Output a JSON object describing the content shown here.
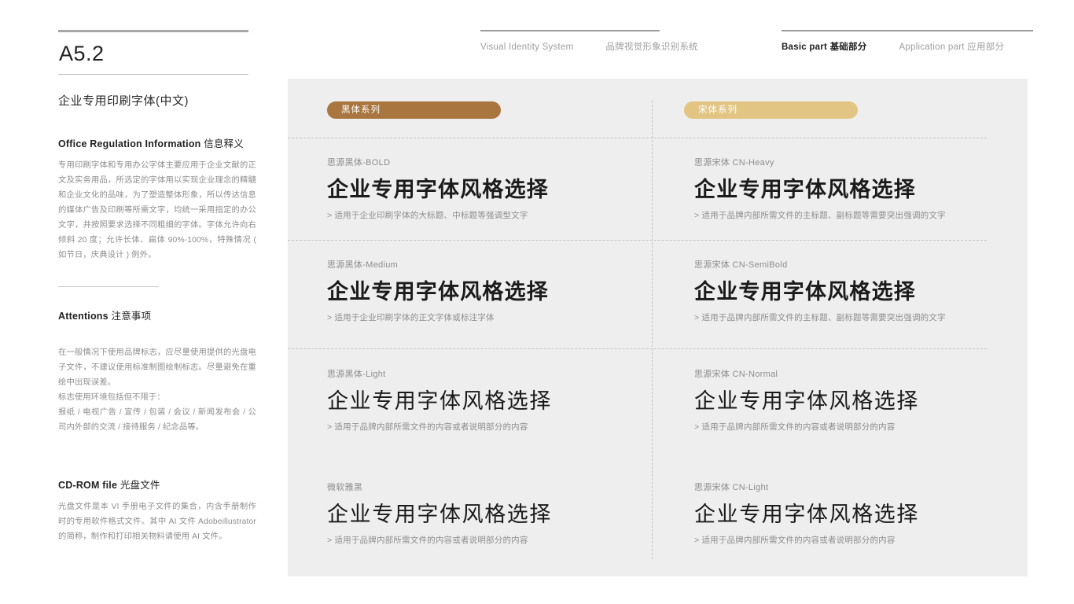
{
  "sidebar": {
    "code": "A5.2",
    "subject": "企业专用印刷字体(中文)",
    "sections": [
      {
        "heading_en": "Office Regulation Information",
        "heading_cn": "信息释义",
        "body": "专用印刷字体和专用办公字体主要应用于企业文献的正文及实务用品，所选定的字体用以实现企业理念的精髓和企业文化的品味，为了塑造整体形象，所以传达信息的媒体广告及印刷等所需文字，均统一采用指定的办公文字，并按照要求选择不同粗细的字体。字体允许向右倾斜 20 度；允许长体、扁体 90%-100%，特殊情况 ( 如节日，庆典设计 ) 例外。"
      },
      {
        "heading_en": "Attentions",
        "heading_cn": "注意事项",
        "body": "在一般情况下使用品牌标志，应尽量使用提供的光盘电子文件，不建议使用标准制图绘制标志。尽量避免在重绘中出现误差。\n标志使用环境包括但不限于：\n报纸 / 电视广告 / 宣传 / 包装 / 会议 / 新闻发布会 / 公司内外部的交流 / 接待服务 / 纪念品等。"
      },
      {
        "heading_en": "CD-ROM file",
        "heading_cn": "光盘文件",
        "body": "光盘文件是本 VI 手册电子文件的集合，内含手册制作时的专用软件格式文件。其中 AI 文件 Adobeillustrator 的简称，制作和打印相关物料请使用 AI 文件。"
      }
    ]
  },
  "header": {
    "system_en": "Visual Identity System",
    "system_cn": "品牌视觉形象识别系统",
    "basic_en": "Basic part",
    "basic_cn": "基础部分",
    "application_en": "Application part",
    "application_cn": "应用部分"
  },
  "panel": {
    "pills": [
      {
        "label": "黑体系列",
        "color": "#a9763f"
      },
      {
        "label": "宋体系列",
        "color": "#e2c583"
      }
    ],
    "samples": [
      {
        "name": "思源黑体-BOLD",
        "sample": "企业专用字体风格选择",
        "note": "> 适用于企业印刷字体的大标题、中标题等强调型文字"
      },
      {
        "name": "思源黑体-Medium",
        "sample": "企业专用字体风格选择",
        "note": "> 适用于企业印刷字体的正文字体或标注字体"
      },
      {
        "name": "思源黑体-Light",
        "sample": "企业专用字体风格选择",
        "note": "> 适用于品牌内部所需文件的内容或者说明部分的内容"
      },
      {
        "name": "微软雅黑",
        "sample": "企业专用字体风格选择",
        "note": "> 适用于品牌内部所需文件的内容或者说明部分的内容"
      },
      {
        "name": "思源宋体 CN-Heavy",
        "sample": "企业专用字体风格选择",
        "note": "> 适用于品牌内部所需文件的主标题、副标题等需要突出强调的文字"
      },
      {
        "name": "思源宋体 CN-SemiBold",
        "sample": "企业专用字体风格选择",
        "note": "> 适用于品牌内部所需文件的主标题、副标题等需要突出强调的文字"
      },
      {
        "name": "思源宋体 CN-Normal",
        "sample": "企业专用字体风格选择",
        "note": "> 适用于品牌内部所需文件的内容或者说明部分的内容"
      },
      {
        "name": "思源宋体 CN-Light",
        "sample": "企业专用字体风格选择",
        "note": "> 适用于品牌内部所需文件的内容或者说明部分的内容"
      }
    ]
  }
}
